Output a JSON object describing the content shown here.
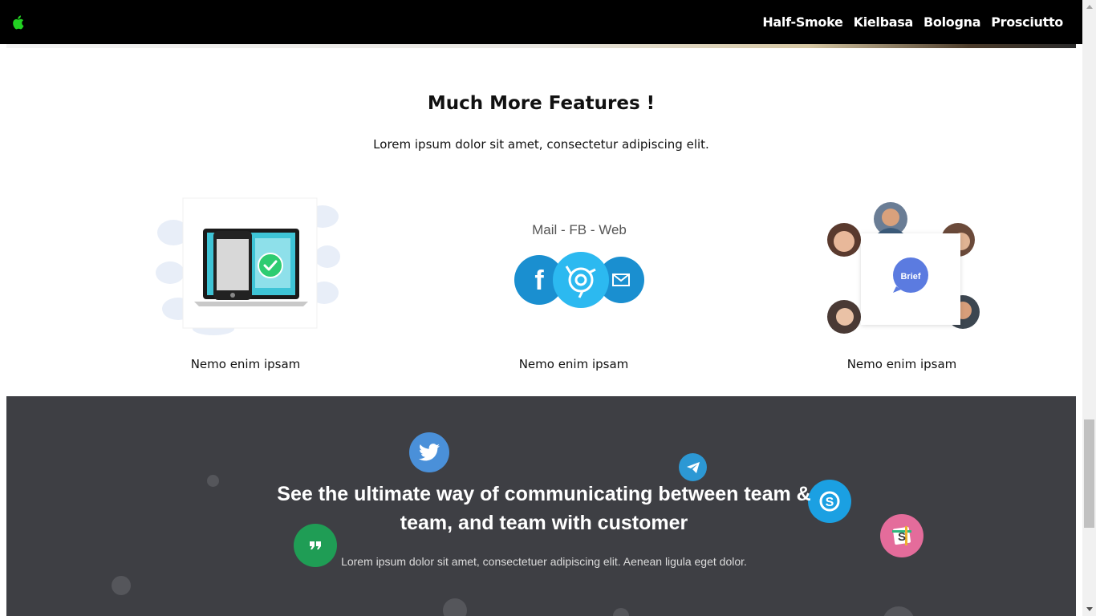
{
  "nav": {
    "logo_icon": "apple-icon",
    "logo_color": "#22d022",
    "links": [
      "Half-Smoke",
      "Kielbasa",
      "Bologna",
      "Prosciutto"
    ]
  },
  "features": {
    "title": "Much More Features !",
    "subtitle": "Lorem ipsum dolor sit amet, consectetur adipiscing elit.",
    "items": [
      {
        "caption": "Nemo enim ipsam",
        "icon": "laptop-phone-check-icon"
      },
      {
        "caption": "Nemo enim ipsam",
        "icon": "mail-fb-web-icon",
        "art_label": "Mail - FB - Web"
      },
      {
        "caption": "Nemo enim ipsam",
        "icon": "team-avatars-icon",
        "art_label": "Brief"
      }
    ]
  },
  "cta": {
    "title_line1": "See the ultimate way of communicating between team &",
    "title_line2": "team, and team with customer",
    "subtitle": "Lorem ipsum dolor sit amet, consectetuer adipiscing elit. Aenean ligula eget dolor.",
    "background": "#3e3f44",
    "bubbles": [
      {
        "icon": "twitter-icon",
        "color": "#4a90d9"
      },
      {
        "icon": "telegram-icon",
        "color": "#2c98d4"
      },
      {
        "icon": "skype-icon",
        "color": "#1ba0e2"
      },
      {
        "icon": "hangouts-icon",
        "color": "#1f9d55"
      },
      {
        "icon": "slack-icon",
        "color": "#e46c9b"
      }
    ]
  }
}
